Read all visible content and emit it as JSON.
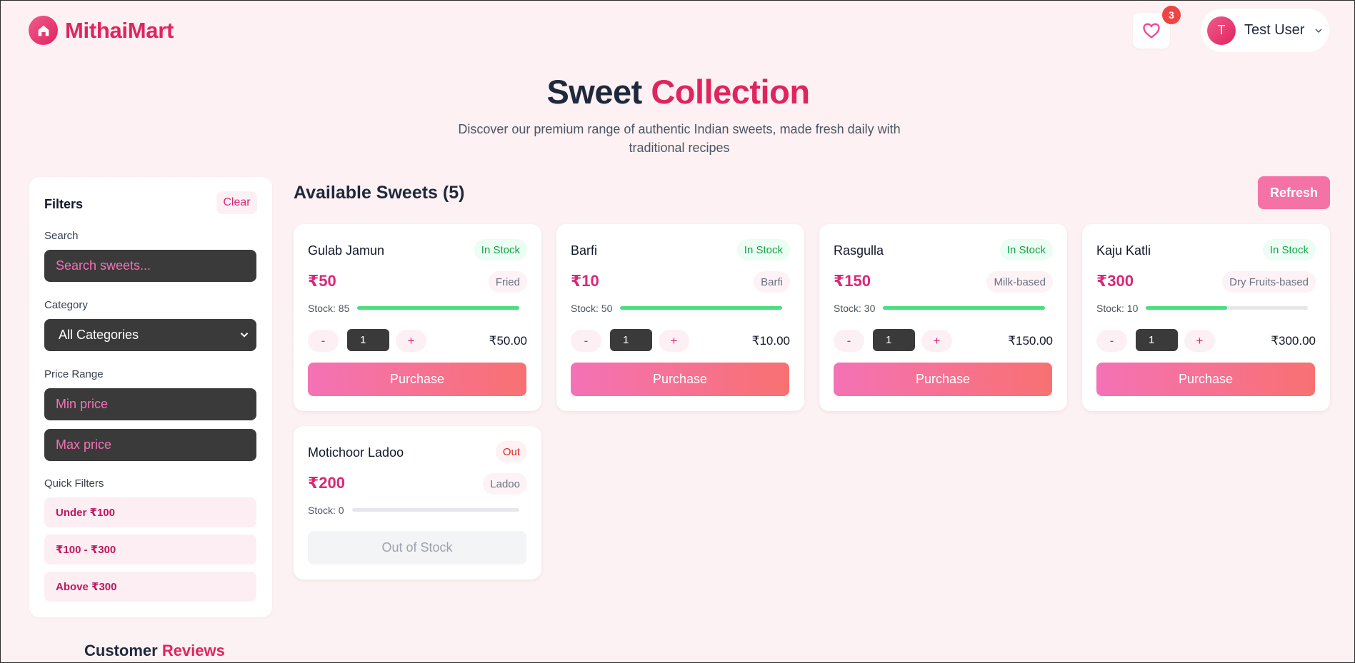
{
  "brand": {
    "name": "MithaiMart",
    "icon": "home-icon"
  },
  "header": {
    "wishlist_count": "3",
    "user_initial": "T",
    "user_name": "Test User"
  },
  "hero": {
    "title_main": "Sweet",
    "title_accent": "Collection",
    "subtitle": "Discover our premium range of authentic Indian sweets, made fresh daily with traditional recipes"
  },
  "filters": {
    "title": "Filters",
    "clear_label": "Clear",
    "search_label": "Search",
    "search_placeholder": "Search sweets...",
    "category_label": "Category",
    "category_value": "All Categories",
    "price_label": "Price Range",
    "min_placeholder": "Min price",
    "max_placeholder": "Max price",
    "quick_label": "Quick Filters",
    "quick": [
      "Under ₹100",
      "₹100 - ₹300",
      "Above ₹300"
    ]
  },
  "main": {
    "title": "Available Sweets (5)",
    "refresh_label": "Refresh"
  },
  "sweets": [
    {
      "name": "Gulab Jamun",
      "status": "In Stock",
      "price": "₹50",
      "category": "Fried",
      "stock_text": "Stock: 85",
      "stock_fraction": 1.0,
      "qty": "1",
      "total": "₹50.00",
      "action": "Purchase",
      "in_stock": true
    },
    {
      "name": "Barfi",
      "status": "In Stock",
      "price": "₹10",
      "category": "Barfi",
      "stock_text": "Stock: 50",
      "stock_fraction": 1.0,
      "qty": "1",
      "total": "₹10.00",
      "action": "Purchase",
      "in_stock": true
    },
    {
      "name": "Rasgulla",
      "status": "In Stock",
      "price": "₹150",
      "category": "Milk-based",
      "stock_text": "Stock: 30",
      "stock_fraction": 1.0,
      "qty": "1",
      "total": "₹150.00",
      "action": "Purchase",
      "in_stock": true
    },
    {
      "name": "Kaju Katli",
      "status": "In Stock",
      "price": "₹300",
      "category": "Dry Fruits-based",
      "stock_text": "Stock: 10",
      "stock_fraction": 0.5,
      "qty": "1",
      "total": "₹300.00",
      "action": "Purchase",
      "in_stock": true
    },
    {
      "name": "Motichoor Ladoo",
      "status": "Out",
      "price": "₹200",
      "category": "Ladoo",
      "stock_text": "Stock: 0",
      "stock_fraction": 0,
      "action": "Out of Stock",
      "in_stock": false
    }
  ],
  "qty_controls": {
    "minus": "-",
    "plus": "+"
  },
  "reviews": {
    "title_main": "Customer",
    "title_accent": "Reviews"
  },
  "colors": {
    "accent": "#e0245e",
    "stock_bar": "#4ade80",
    "in_stock": "#16a34a",
    "out_stock": "#dc2626"
  }
}
